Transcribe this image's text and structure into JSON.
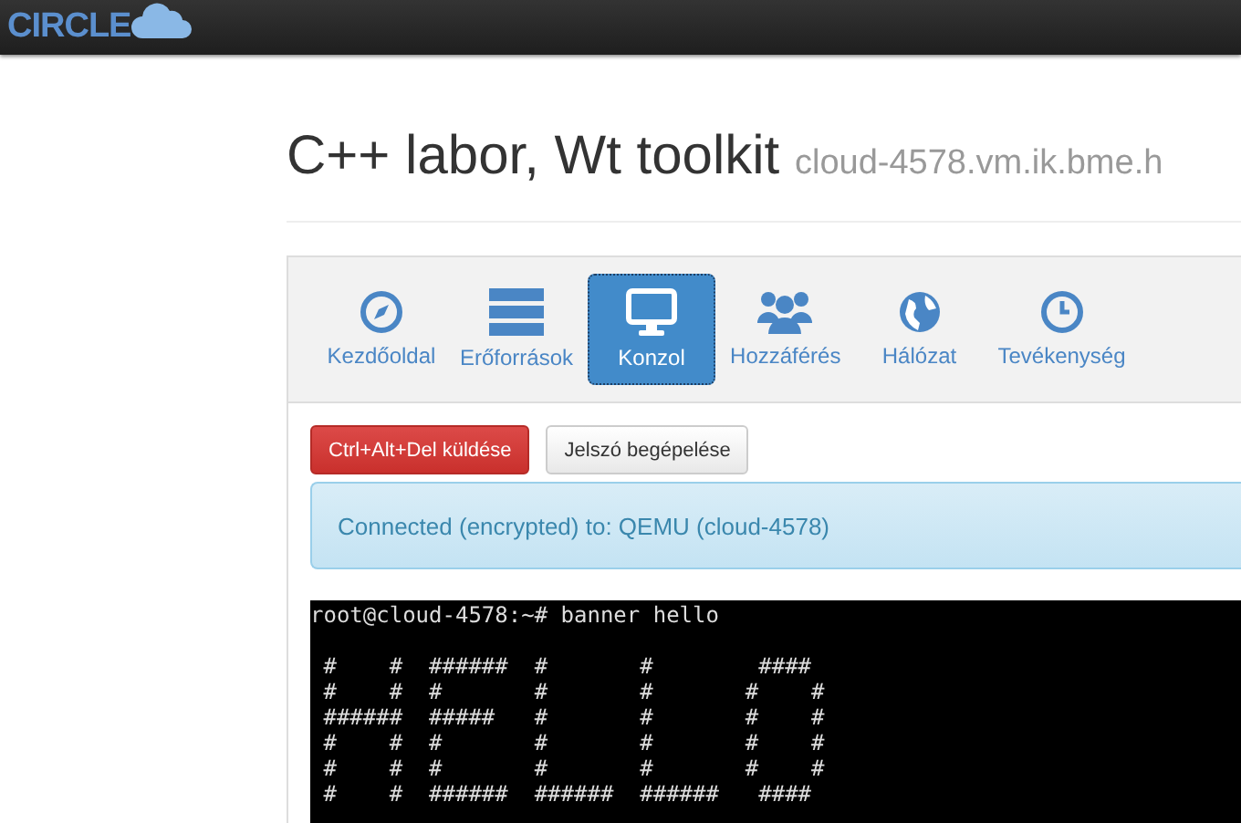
{
  "navbar": {
    "logo": "CIRCLE"
  },
  "header": {
    "title": "C++ labor, Wt toolkit",
    "subtitle": "cloud-4578.vm.ik.bme.h"
  },
  "tabs": [
    {
      "label": "Kezdőoldal",
      "selected": false
    },
    {
      "label": "Erőforrások",
      "selected": false
    },
    {
      "label": "Konzol",
      "selected": true
    },
    {
      "label": "Hozzáférés",
      "selected": false
    },
    {
      "label": "Hálózat",
      "selected": false
    },
    {
      "label": "Tevékenység",
      "selected": false
    }
  ],
  "buttons": [
    {
      "label": "Ctrl+Alt+Del küldése",
      "kind": "danger"
    },
    {
      "label": "Jelszó begépelése",
      "kind": "default"
    }
  ],
  "alert": "Connected (encrypted) to: QEMU (cloud-4578)",
  "console": {
    "command": "root@cloud-4578:~# banner hello",
    "output": [
      " #    #  ######  #       #        ####",
      " #    #  #       #       #       #    #",
      " ######  #####   #       #       #    #",
      " #    #  #       #       #       #    #",
      " #    #  #       #       #       #    #",
      " #    #  ######  ######  ######   ####"
    ]
  }
}
